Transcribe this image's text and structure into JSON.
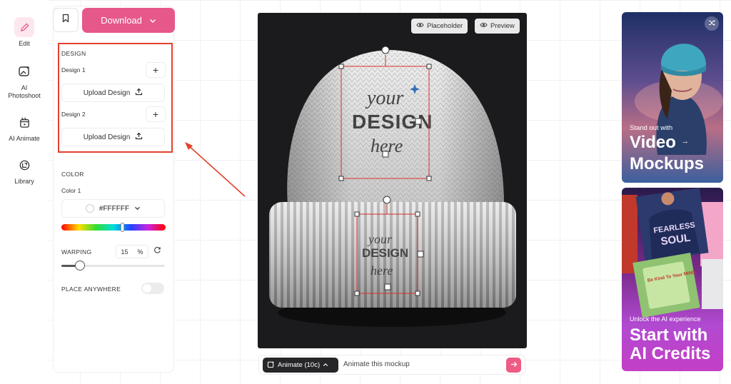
{
  "nav": {
    "items": [
      {
        "label": "Edit",
        "icon": "edit-icon"
      },
      {
        "label": "AI\nPhotoshoot",
        "icon": "ai-photoshoot-icon"
      },
      {
        "label": "AI Animate",
        "icon": "ai-animate-icon"
      },
      {
        "label": "Library",
        "icon": "library-icon"
      }
    ]
  },
  "toolbar": {
    "download_label": "Download"
  },
  "design": {
    "section_title": "DESIGN",
    "design1_label": "Design 1",
    "design2_label": "Design 2",
    "upload_label": "Upload Design"
  },
  "color": {
    "section_title": "COLOR",
    "color1_label": "Color 1",
    "value": "#FFFFFF",
    "hue_position": 0.58
  },
  "warping": {
    "label": "WARPING",
    "value": "15",
    "unit": "%",
    "slider_fraction": 0.18
  },
  "place_anywhere": {
    "label": "PLACE ANYWHERE",
    "enabled": false
  },
  "canvas": {
    "placeholder_label": "Placeholder",
    "preview_label": "Preview",
    "design_text": {
      "line1": "your",
      "line2": "DESIGN",
      "line3": "here"
    }
  },
  "animate": {
    "button_label": "Animate (10c)",
    "input_text": "Animate this mockup"
  },
  "ads": {
    "ad1": {
      "small": "Stand out with",
      "line1": "Video",
      "line2": "Mockups"
    },
    "ad2": {
      "small": "Unlock the AI experience",
      "line1": "Start with",
      "line2": "AI Credits",
      "tshirt_text1": "FEARLESS",
      "tshirt_text2": "SOUL",
      "tshirt2_text": "Be Kind To Your MIND"
    }
  },
  "colors": {
    "accent": "#e6588a",
    "highlight": "#e2412d",
    "canvas_bg": "#1b1b1d",
    "frame_red": "#d9302a"
  }
}
